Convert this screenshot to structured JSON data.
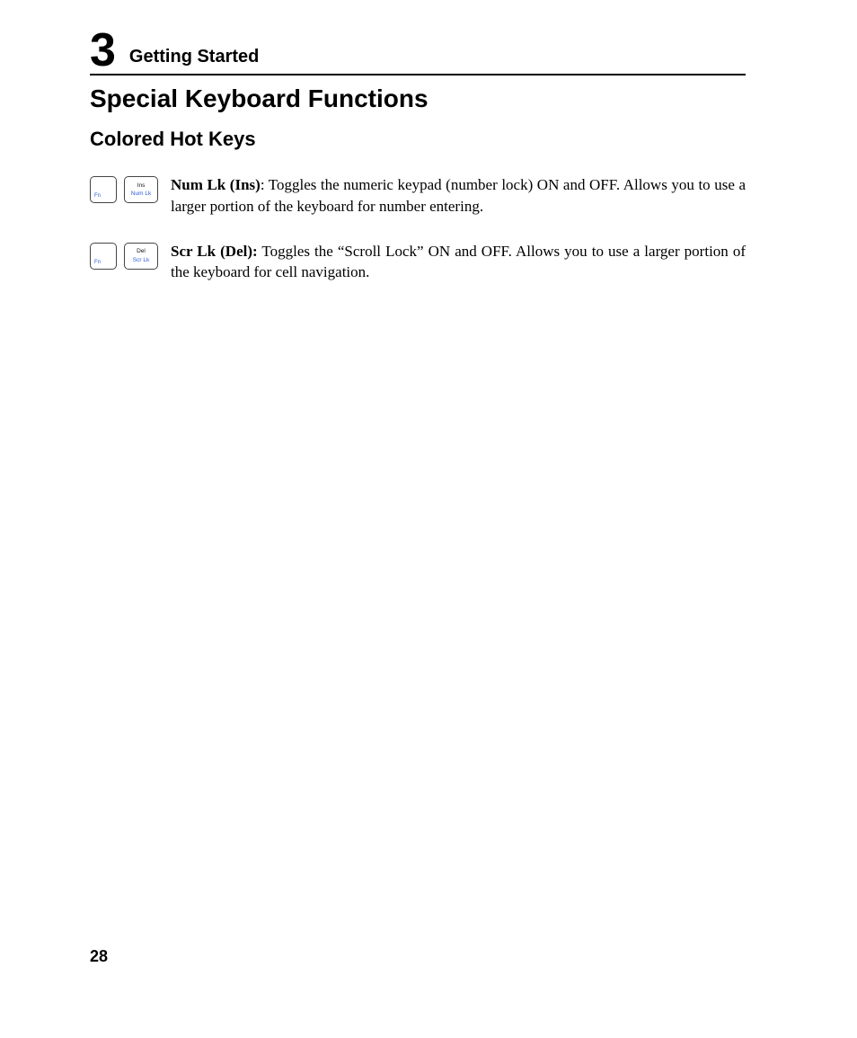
{
  "chapter": {
    "number": "3",
    "title": "Getting Started"
  },
  "h1": "Special Keyboard Functions",
  "h2": "Colored Hot Keys",
  "entries": [
    {
      "fn": "Fn",
      "key_top": "Ins",
      "key_bot": "Num Lk",
      "bold": "Num Lk (Ins)",
      "sep": ": ",
      "text": "Toggles the numeric keypad (number lock) ON and OFF. Allows you to use a larger portion of the keyboard for number entering."
    },
    {
      "fn": "Fn",
      "key_top": "Del",
      "key_bot": "Scr Lk",
      "bold": "Scr Lk (Del):",
      "sep": " ",
      "text": "Toggles the “Scroll Lock” ON and OFF. Allows you to use a larger portion of the keyboard for cell navigation."
    }
  ],
  "page_number": "28"
}
